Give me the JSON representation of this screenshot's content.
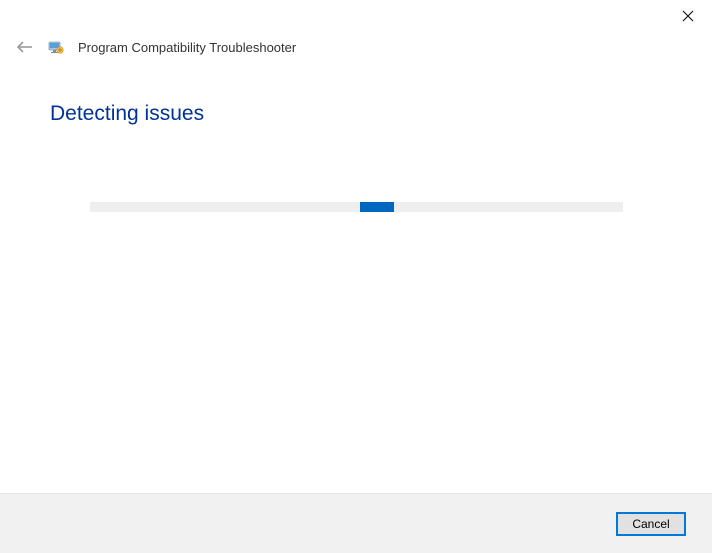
{
  "window": {
    "app_title": "Program Compatibility Troubleshooter"
  },
  "content": {
    "heading": "Detecting issues"
  },
  "footer": {
    "cancel_label": "Cancel"
  }
}
